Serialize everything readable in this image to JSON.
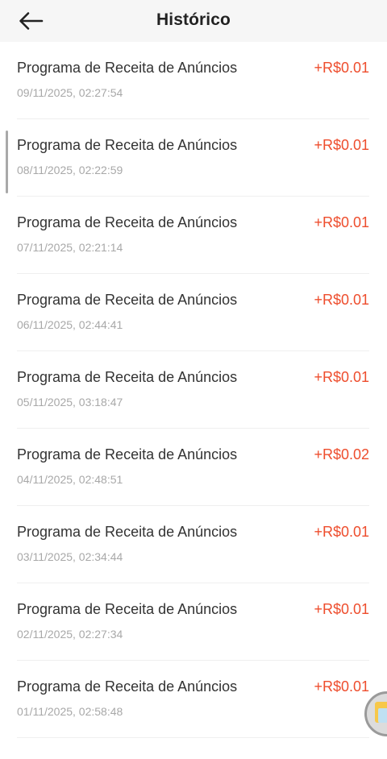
{
  "header": {
    "title": "Histórico"
  },
  "items": [
    {
      "title": "Programa de Receita de Anúncios",
      "date": "09/11/2025, 02:27:54",
      "amount": "+R$0.01"
    },
    {
      "title": "Programa de Receita de Anúncios",
      "date": "08/11/2025, 02:22:59",
      "amount": "+R$0.01"
    },
    {
      "title": "Programa de Receita de Anúncios",
      "date": "07/11/2025, 02:21:14",
      "amount": "+R$0.01"
    },
    {
      "title": "Programa de Receita de Anúncios",
      "date": "06/11/2025, 02:44:41",
      "amount": "+R$0.01"
    },
    {
      "title": "Programa de Receita de Anúncios",
      "date": "05/11/2025, 03:18:47",
      "amount": "+R$0.01"
    },
    {
      "title": "Programa de Receita de Anúncios",
      "date": "04/11/2025, 02:48:51",
      "amount": "+R$0.02"
    },
    {
      "title": "Programa de Receita de Anúncios",
      "date": "03/11/2025, 02:34:44",
      "amount": "+R$0.01"
    },
    {
      "title": "Programa de Receita de Anúncios",
      "date": "02/11/2025, 02:27:34",
      "amount": "+R$0.01"
    },
    {
      "title": "Programa de Receita de Anúncios",
      "date": "01/11/2025, 02:58:48",
      "amount": "+R$0.01"
    }
  ],
  "icons": {
    "back": "back-arrow-icon",
    "floating": "floating-app-icon"
  },
  "colors": {
    "amount": "#ee4d2d",
    "header_bg": "#f6f6f6",
    "date": "#a8a8a8"
  }
}
